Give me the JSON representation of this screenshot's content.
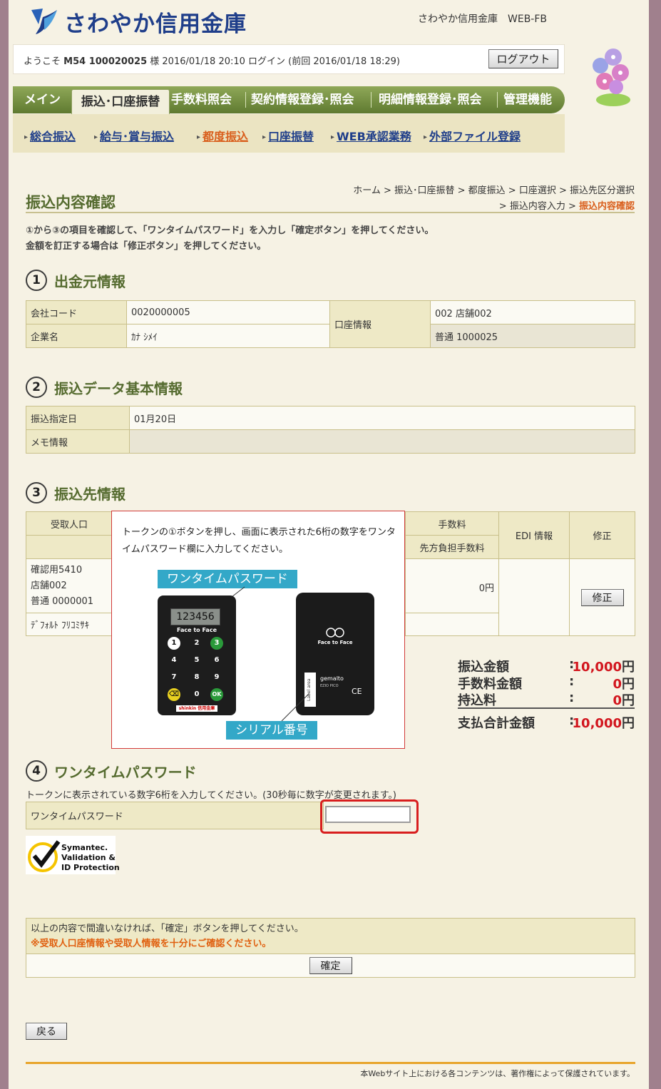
{
  "header": {
    "bank_name": "さわやか信用金庫",
    "system_name": "さわやか信用金庫　WEB-FB",
    "welcome_prefix": "ようこそ",
    "user_id": "M54 100020025",
    "welcome_suffix": "様 2016/01/18 20:10 ログイン (前回 2016/01/18 18:29)",
    "logout_label": "ログアウト"
  },
  "main_nav": [
    "メイン",
    "振込･口座振替",
    "手数料照会",
    "契約情報登録･照会",
    "明細情報登録･照会",
    "管理機能"
  ],
  "sub_nav": [
    "総合振込",
    "給与･賞与振込",
    "都度振込",
    "口座振替",
    "WEB承認業務",
    "外部ファイル登録"
  ],
  "breadcrumb": {
    "line1": "ホーム > 振込･口座振替 > 都度振込 > 口座選択 > 振込先区分選択",
    "line2_prefix": "> 振込内容入力 > ",
    "current": "振込内容確認"
  },
  "page_title": "振込内容確認",
  "instructions": [
    "①から③の項目を確認して、「ワンタイムパスワード」を入力し「確定ボタン」を押してください。",
    "金額を訂正する場合は「修正ボタン」を押してください。"
  ],
  "section1": {
    "number": "1",
    "title": "出金元情報",
    "company_code_label": "会社コード",
    "company_code": "0020000005",
    "company_name_label": "企業名",
    "company_name": "ｶﾅ ｼﾒｲ",
    "account_label": "口座情報",
    "branch": "002 店舗002",
    "account": "普通 1000025"
  },
  "section2": {
    "number": "2",
    "title": "振込データ基本情報",
    "date_label": "振込指定日",
    "date": "01月20日",
    "memo_label": "メモ情報",
    "memo": ""
  },
  "section3": {
    "number": "3",
    "title": "振込先情報",
    "header_recipient": "受取人口",
    "header_fee": "手数料",
    "header_fee_sub": "先方負担手数料",
    "header_edi": "EDI 情報",
    "header_edit": "修正",
    "recipient_lines": [
      "確認用5410",
      "店舗002",
      "普通 0000001"
    ],
    "recipient_kana": "ﾃﾞﾌｫﾙﾄ ﾌﾘｺﾐｻｷ",
    "fee": "0円",
    "edit_button": "修正"
  },
  "summary": {
    "transfer_label": "振込金額",
    "transfer_value": "10,000",
    "fee_label": "手数料金額",
    "fee_value": "0",
    "mochikomi_label": "持込料",
    "mochikomi_value": "0",
    "total_label": "支払合計金額",
    "total_value": "10,000",
    "colon": ":",
    "unit": "円"
  },
  "overlay": {
    "text": "トークンの①ボタンを押し、画面に表示された6桁の数字をワンタイムパスワード欄に入力してください。",
    "otp_tag": "ワンタイムパスワード",
    "serial_tag": "シリアル番号",
    "token_display": "123456",
    "token_brand": "Face to Face",
    "token_back_brand": "Face to Face",
    "token_maker": "gemalto",
    "token_model": "EZIO PICO",
    "token_bottom_label": "shinkin 信用金庫",
    "label_area_text": "Label area"
  },
  "section4": {
    "number": "4",
    "title": "ワンタイムパスワード",
    "note": "トークンに表示されている数字6桁を入力してください。(30秒毎に数字が変更されます。)",
    "field_label": "ワンタイムパスワード",
    "field_value": ""
  },
  "symantec": {
    "line1": "Symantec.",
    "line2": "Validation &",
    "line3": "ID Protection"
  },
  "confirm": {
    "text": "以上の内容で間違いなければ、「確定」ボタンを押してください。",
    "warning": "※受取人口座情報や受取人情報を十分にご確認ください。",
    "button": "確定"
  },
  "back_button": "戻る",
  "footer": "本Webサイト上における各コンテンツは、著作権によって保護されています。",
  "colors": {
    "accent_green": "#556b2f",
    "link_blue": "#1f3e8a",
    "current_orange": "#d95e1c",
    "alert_red": "#d2161e",
    "tag_blue": "#33a8c8"
  }
}
